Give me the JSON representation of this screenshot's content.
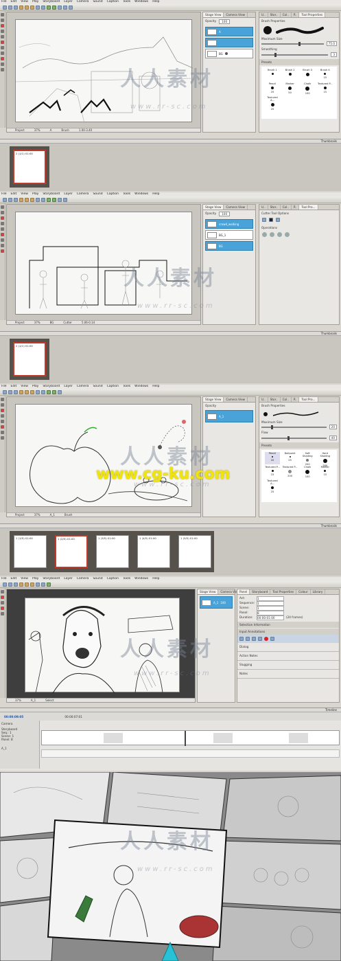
{
  "menu": [
    "File",
    "Edit",
    "View",
    "Play",
    "Storyboard",
    "Layer",
    "Camera",
    "Sound",
    "Caption",
    "Tools",
    "Windows",
    "Help"
  ],
  "shot1": {
    "stage_tabs": [
      "Stage View",
      "Camera View"
    ],
    "opacity_label": "Opacity",
    "opacity_value": "100",
    "layers": [
      "A",
      "",
      "BG"
    ],
    "right_tabs": [
      "U..",
      "Stor..",
      "Col..",
      "P..",
      "Tool Properties"
    ],
    "brush_properties": "Brush Properties",
    "max_size": "Maximum Size",
    "max_size_value": "75.0",
    "smoothing": "Smoothing",
    "smoothing_value": "3",
    "presets_label": "Presets",
    "presets": [
      {
        "name": "Brush 1",
        "size": ""
      },
      {
        "name": "Brush 2",
        "size": ""
      },
      {
        "name": "Brush 3",
        "size": ""
      },
      {
        "name": "Brush 4",
        "size": "15"
      },
      {
        "name": "Pencil",
        "size": "25"
      },
      {
        "name": "Marker",
        "size": "50"
      },
      {
        "name": "Chalk",
        "size": "100"
      },
      {
        "name": "Textured P...",
        "size": "15"
      },
      {
        "name": "Textured A...",
        "size": "25"
      }
    ],
    "footer": [
      "Project",
      "37%",
      "A",
      "Brush",
      "1.00-3.40"
    ],
    "thumbnails_label": "Thumbnails",
    "frames": [
      "2 (1/1) 01:00"
    ]
  },
  "shot2": {
    "stage_tabs": [
      "Stage View",
      "Camera View"
    ],
    "opacity_label": "Opacity",
    "opacity_value": "100",
    "layers": [
      "crowd_walking",
      "BG_1",
      "BG"
    ],
    "right_tabs": [
      "U..",
      "Stor..",
      "Col..",
      "P..",
      "Tool Pro..."
    ],
    "cutter_options": "Cutter Tool Options",
    "operations": "Operations",
    "footer": [
      "Project",
      "37%",
      "BG",
      "Cutter",
      "5.06-0.14"
    ],
    "thumbnails_label": "Thumbnails",
    "frames": [
      "2 (1/1) 01:00"
    ]
  },
  "shot3": {
    "stage_tabs": [
      "Stage View",
      "Camera View"
    ],
    "opacity_label": "Opacity",
    "layers": [
      "A_1"
    ],
    "right_tabs": [
      "U..",
      "Stor..",
      "Col..",
      "P..",
      "Tool Pro..."
    ],
    "brush_properties": "Brush Properties",
    "max_size": "Maximum Size",
    "max_size_value": "20",
    "flow": "Flow",
    "flow_value": "40",
    "presets_label": "Presets",
    "presets": [
      {
        "name": "Pencil",
        "size": "20"
      },
      {
        "name": "Ballpoint",
        "size": "25"
      },
      {
        "name": "Soft Shading",
        "size": "200"
      },
      {
        "name": "Hard Shading",
        "size": "300"
      },
      {
        "name": "Textured P...",
        "size": "15"
      },
      {
        "name": "Textured P...",
        "size": "200"
      },
      {
        "name": "Chalk",
        "size": "100"
      },
      {
        "name": "Marker",
        "size": "15"
      },
      {
        "name": "Textured A...",
        "size": "25"
      }
    ],
    "footer": [
      "Project",
      "37%",
      "A_1",
      "Brush"
    ],
    "thumbnails_label": "Thumbnails",
    "frames": [
      "1 (1/5) 01:00",
      "1 (2/5) 01:00",
      "1 (3/5) 01:00",
      "1 (4/5) 01:00",
      "1 (5/5) 01:00"
    ]
  },
  "shot4": {
    "stage_tabs": [
      "Stage View",
      "Camera View"
    ],
    "opacity_value": "100",
    "layers": [
      "A_1"
    ],
    "right_tabs": [
      "Panel",
      "Storyboard",
      "Tool Properties",
      "Colour",
      "Library"
    ],
    "fields": [
      {
        "label": "Act:",
        "value": "1"
      },
      {
        "label": "Sequence:",
        "value": "1"
      },
      {
        "label": "Scene:",
        "value": "1"
      },
      {
        "label": "Panel:",
        "value": "8"
      },
      {
        "label": "Duration:",
        "value": "00:00:01:00",
        "extra": "(24 frames)"
      }
    ],
    "selection_info": "Selection Information",
    "input_annotations": "Input Annotations",
    "sections": [
      "Dialog",
      "Action Notes",
      "Slugging",
      "Notes"
    ],
    "footer": [
      "37%",
      "A_1",
      "Select"
    ],
    "timeline_label": "Timeline",
    "timecode": "00:00:09:05",
    "timecode2": "00:00:07:01",
    "track_labels": [
      "Camera",
      "Storyboard",
      "Seq.: 1",
      "Scene: 1",
      "Panel: 8"
    ],
    "audio_label": "A_1"
  },
  "watermarks": {
    "cn": "人人素材",
    "sub": "www.rr-sc.com",
    "yellow": "www.cg-ku.com"
  },
  "colors": {
    "accent_blue": "#4aa3d8",
    "selected_red": "#c0392b",
    "ui_gray": "#d9d6d0"
  }
}
